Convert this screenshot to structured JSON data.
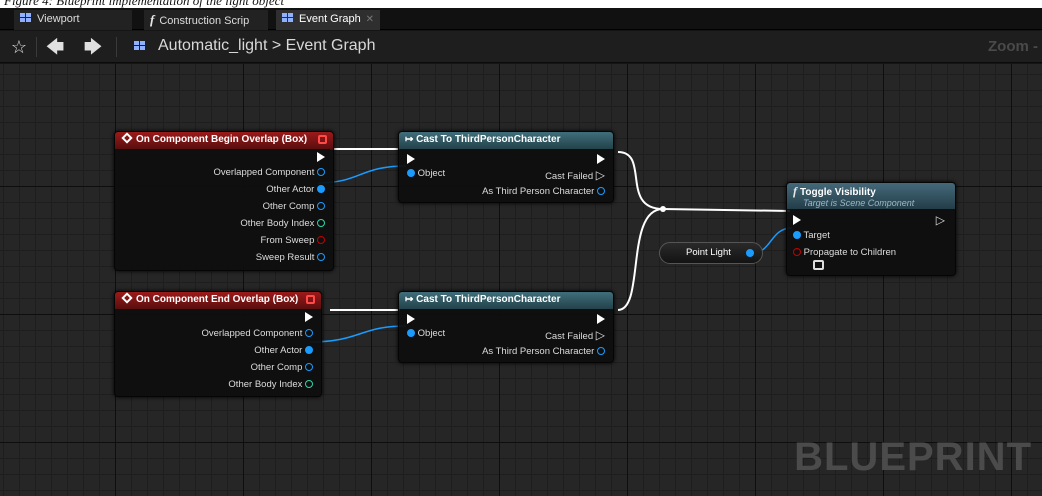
{
  "caption": "Figure 4: Blueprint implementation of the light object",
  "tabs": [
    {
      "label": "Viewport",
      "icon": "viewport-icon"
    },
    {
      "label": "Construction Scrip",
      "icon": "function-icon"
    },
    {
      "label": "Event Graph",
      "icon": "event-graph-icon"
    }
  ],
  "toolbar": {
    "breadcrumb_root": "Automatic_light",
    "breadcrumb_sep": ">",
    "breadcrumb_current": "Event Graph",
    "zoom_label": "Zoom -"
  },
  "watermark": "BLUEPRINT",
  "nodes": {
    "begin_overlap": {
      "title": "On Component Begin Overlap (Box)",
      "pins": [
        "Overlapped Component",
        "Other Actor",
        "Other Comp",
        "Other Body Index",
        "From Sweep",
        "Sweep Result"
      ]
    },
    "end_overlap": {
      "title": "On Component End Overlap (Box)",
      "pins": [
        "Overlapped Component",
        "Other Actor",
        "Other Comp",
        "Other Body Index"
      ]
    },
    "cast_1": {
      "title": "Cast To ThirdPersonCharacter",
      "object": "Object",
      "failed": "Cast Failed",
      "as": "As Third Person Character"
    },
    "cast_2": {
      "title": "Cast To ThirdPersonCharacter",
      "object": "Object",
      "failed": "Cast Failed",
      "as": "As Third Person Character"
    },
    "toggle": {
      "title": "Toggle Visibility",
      "subtitle": "Target is Scene Component",
      "target": "Target",
      "propagate": "Propagate to Children"
    },
    "point_light": {
      "label": "Point Light"
    }
  },
  "colors": {
    "event_header": "#9c1a1a",
    "cast_header": "#3f6e7a",
    "object_pin": "#1a9cff",
    "int_pin": "#2fd6a5",
    "bool_pin": "#c40000"
  }
}
